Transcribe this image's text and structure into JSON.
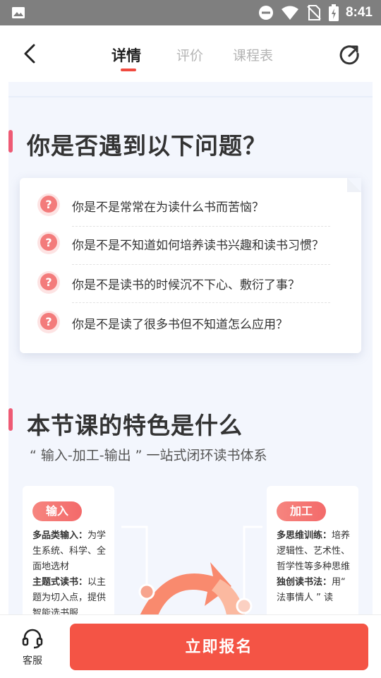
{
  "status_bar": {
    "time": "8:41"
  },
  "header": {
    "tabs": [
      {
        "label": "详情",
        "active": true
      },
      {
        "label": "评价",
        "active": false
      },
      {
        "label": "课程表",
        "active": false
      }
    ]
  },
  "section1": {
    "title": "你是否遇到以下问题？",
    "questions": [
      "你是不是常常在为读什么书而苦恼？",
      "你是不是不知道如何培养读书兴趣和读书习惯？",
      "你是不是读书的时候沉不下心、敷衍了事？",
      "你是不是读了很多书但不知道怎么应用？"
    ]
  },
  "section2": {
    "title": "本节课的特色是什么",
    "subtitle": "“ 输入-加工-输出 ” 一站式闭环读书体系",
    "features": [
      {
        "tag": "输入",
        "item1_label": "多品类输入：",
        "item1_text": "为学生系统、科学、全面地选材",
        "item2_label": "主题式读书：",
        "item2_text": "以主题为切入点，提供智能选书服"
      },
      {
        "tag": "加工",
        "item1_label": "多思维训练：",
        "item1_text": "培养逻辑性、艺术性、哲学性等多种思维",
        "item2_label": "独创读书法：",
        "item2_text": "用“ 法事情人 ” 读"
      }
    ]
  },
  "bottom_bar": {
    "customer_service_label": "客服",
    "enroll_label": "立即报名"
  },
  "colors": {
    "accent": "#f45445",
    "section_bar": "#ee5a74",
    "content_bg": "#f3f6fd",
    "status_bar": "#7f7f7f"
  },
  "icons": [
    "image-icon",
    "dnd-icon",
    "wifi-icon",
    "no-sim-icon",
    "battery-icon",
    "back-arrow-icon",
    "refresh-icon",
    "question-icon",
    "headset-icon"
  ]
}
